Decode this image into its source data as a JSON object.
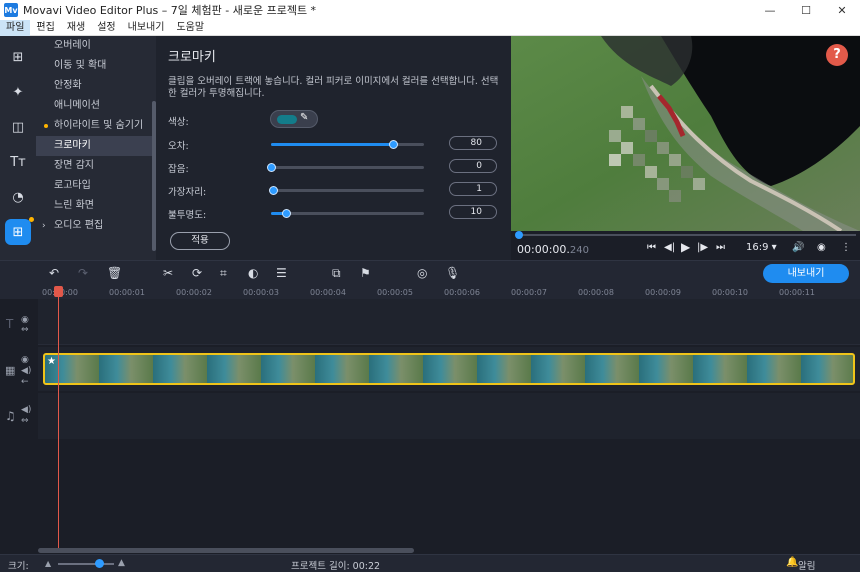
{
  "window": {
    "title": "Movavi Video Editor Plus – 7일 체험판 - 새로운 프로젝트 *",
    "app_icon": "Mv"
  },
  "menu": [
    "파일",
    "편집",
    "재생",
    "설정",
    "내보내기",
    "도움말"
  ],
  "left_tools": [
    "import-icon",
    "magic-wand-icon",
    "transitions-icon",
    "titles-icon",
    "filters-icon",
    "more-tools-icon"
  ],
  "submenu": {
    "items": [
      {
        "label": "오버레이"
      },
      {
        "label": "이동 및 확대"
      },
      {
        "label": "안정화"
      },
      {
        "label": "애니메이션"
      },
      {
        "label": "하이라이트 및 숨기기"
      },
      {
        "label": "크로마키"
      },
      {
        "label": "장면 감지"
      },
      {
        "label": "로고타입"
      },
      {
        "label": "느린 화면"
      },
      {
        "label": "오디오 편집"
      }
    ],
    "selected": "크로마키"
  },
  "chroma": {
    "title": "크로마키",
    "description": "클립을 오버레이 트랙에 놓습니다. 컬러 피커로 이미지에서 컬러를 선택합니다. 선택한 컬러가 투명해집니다.",
    "color_label": "색상:",
    "color_value": "#137c8a",
    "sliders": [
      {
        "label": "오차:",
        "value": "80",
        "fraction": 0.8
      },
      {
        "label": "잡음:",
        "value": "0",
        "fraction": 0.0
      },
      {
        "label": "가장자리:",
        "value": "1",
        "fraction": 0.01
      },
      {
        "label": "불투명도:",
        "value": "10",
        "fraction": 0.1
      }
    ],
    "apply_label": "적용"
  },
  "player": {
    "time_main": "00:00:00.",
    "time_ms": "240",
    "aspect": "16:9",
    "help": "?"
  },
  "toolbar": {
    "export_label": "내보내기"
  },
  "ruler": [
    "00:00:00",
    "00:00:01",
    "00:00:02",
    "00:00:03",
    "00:00:04",
    "00:00:05",
    "00:00:06",
    "00:00:07",
    "00:00:08",
    "00:00:09",
    "00:00:10",
    "00:00:11"
  ],
  "status": {
    "zoom_label": "크기:",
    "project_length": "프로젝트 길이:  00:22",
    "notifications": "알림"
  }
}
